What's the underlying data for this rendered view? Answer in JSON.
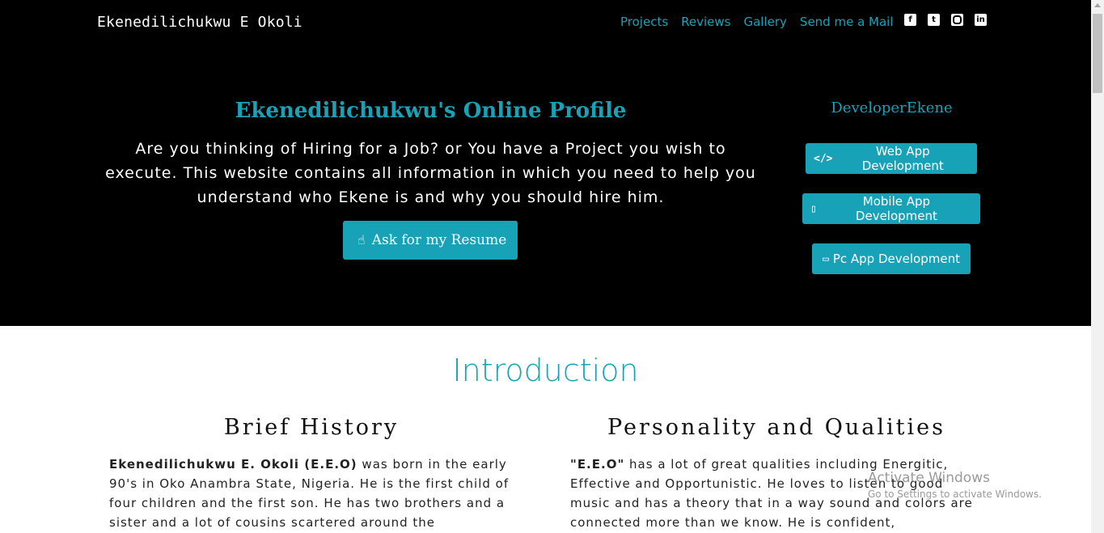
{
  "header": {
    "brand": "Ekenedilichukwu E Okoli",
    "nav": [
      "Projects",
      "Reviews",
      "Gallery",
      "Send me a Mail"
    ],
    "social_icons": [
      "facebook-icon",
      "twitter-icon",
      "instagram-icon",
      "linkedin-icon"
    ]
  },
  "hero": {
    "title": "Ekenedilichukwu's Online Profile",
    "description": "Are you thinking of Hiring for a Job? or You have a Project you wish to execute. This website contains all information in which you need to help you understand who Ekene is and why you should hire him.",
    "resume_button": "Ask for my Resume",
    "resume_icon": "hand-point-icon"
  },
  "side": {
    "title": "DeveloperEkene",
    "buttons": [
      {
        "label": "Web App Development",
        "icon": "code-icon"
      },
      {
        "label": "Mobile App Development",
        "icon": "mobile-icon"
      },
      {
        "label": "Pc App Development",
        "icon": "laptop-icon"
      }
    ]
  },
  "intro": {
    "title": "Introduction",
    "left": {
      "heading": "Brief History",
      "bold": "Ekenedilichukwu E. Okoli (E.E.O)",
      "text": " was born in the early 90's in Oko Anambra State, Nigeria. He is the first child of four children and the first son. He has two brothers and a sister and a lot of cousins scartered around the"
    },
    "right": {
      "heading": "Personality and Qualities",
      "bold": "\"E.E.O\"",
      "text": " has a lot of great qualities including Energitic, Effective and Opportunistic. He loves to listen to good music and has a theory that in a way sound and colors are connected more than we know. He is confident,"
    }
  },
  "watermark": {
    "line1": "Activate Windows",
    "line2": "Go to Settings to activate Windows."
  },
  "colors": {
    "accent": "#17a2b8",
    "hero_bg": "#000000"
  }
}
